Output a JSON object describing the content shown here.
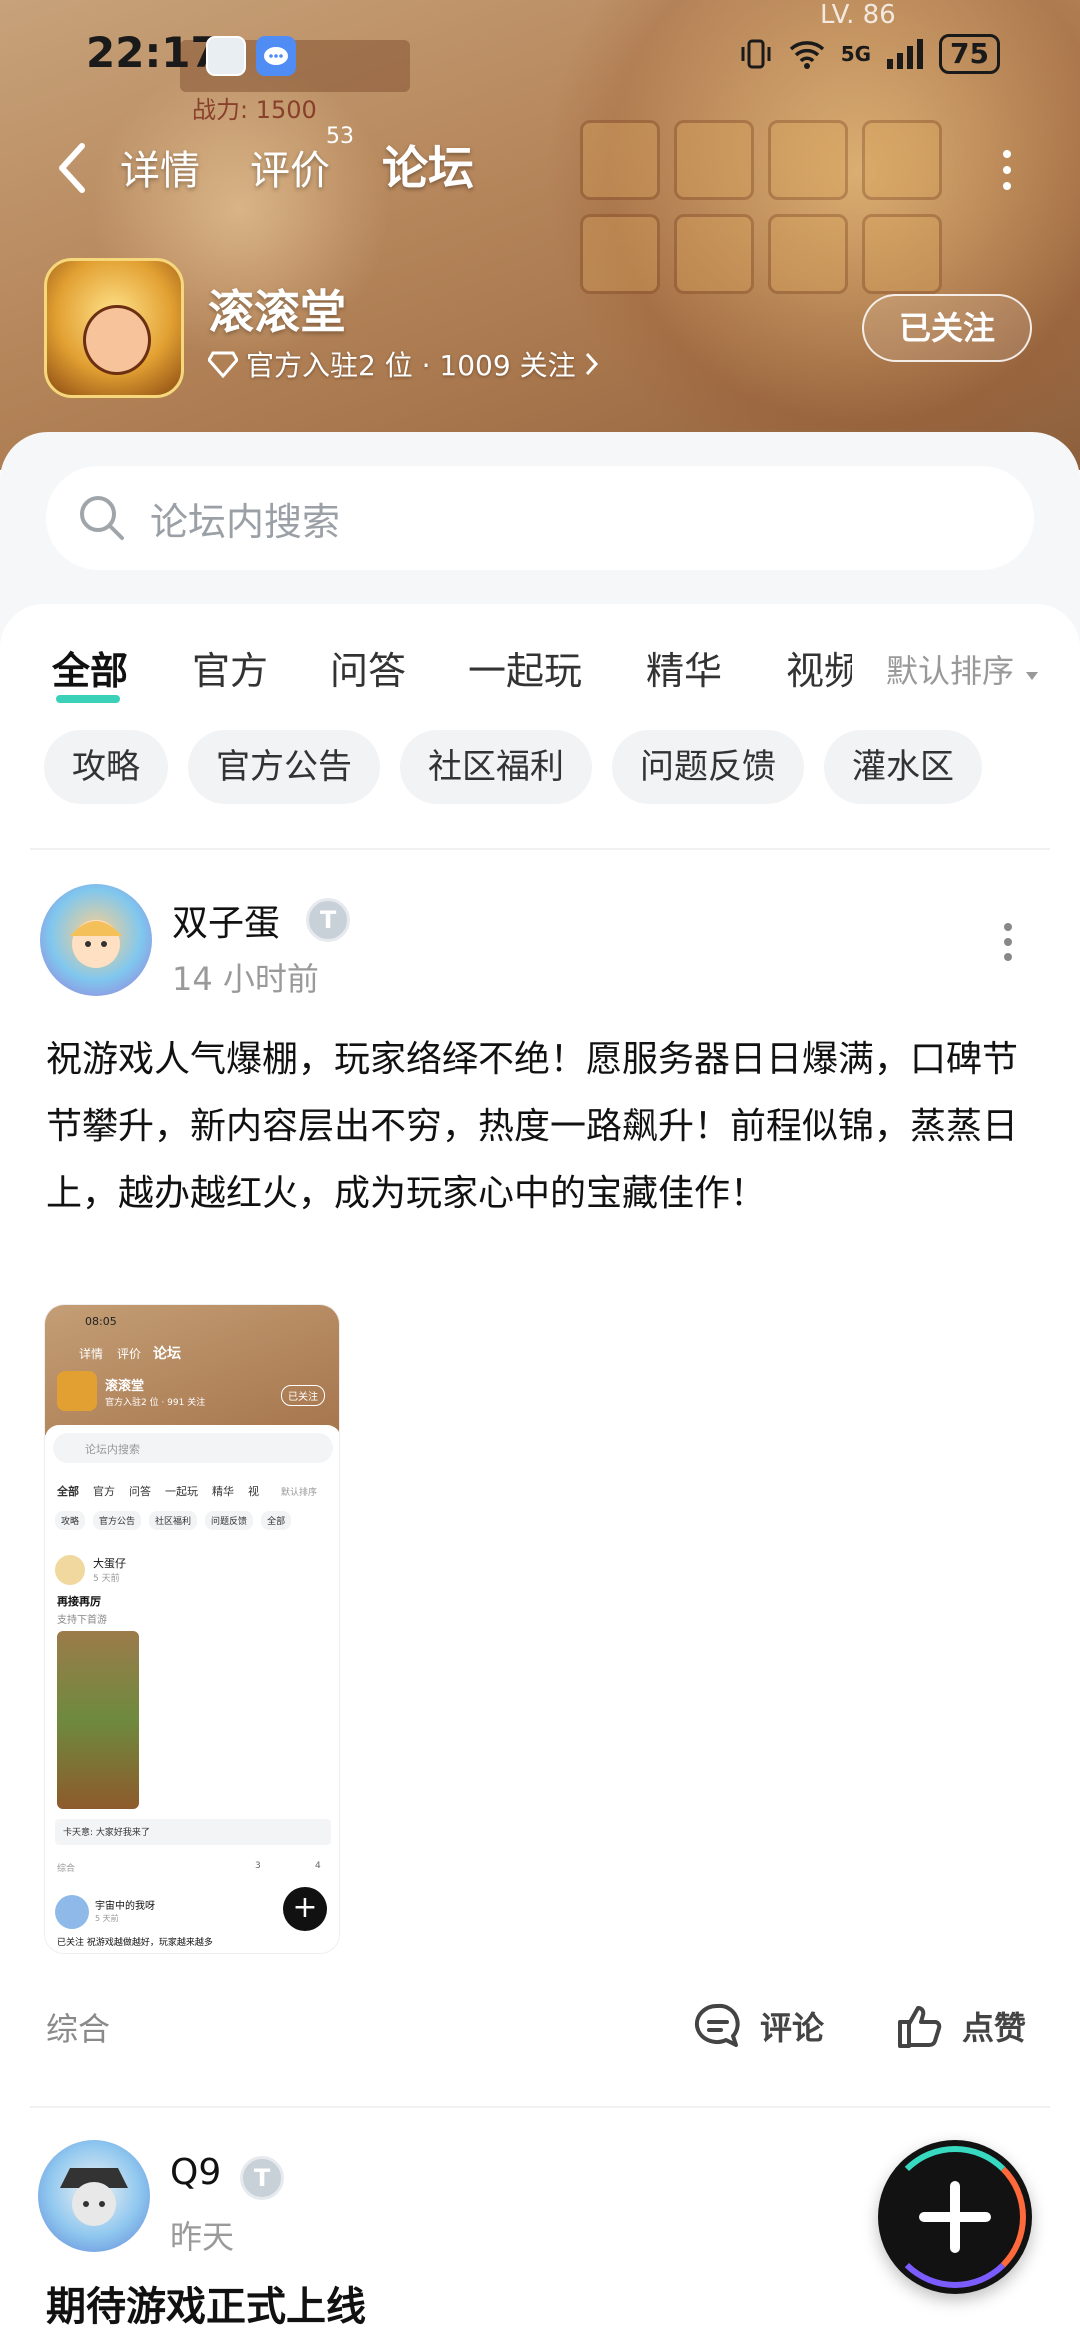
{
  "status_bar": {
    "time": "22:17",
    "signal": "5G",
    "battery": "75"
  },
  "hero": {
    "game_level": "LV. 86",
    "power_label": "战力: 1500"
  },
  "nav": {
    "tabs": [
      {
        "label": "详情"
      },
      {
        "label": "评价",
        "badge": "53"
      },
      {
        "label": "论坛"
      }
    ],
    "active": "论坛"
  },
  "app": {
    "name": "滚滚堂",
    "meta": "官方入驻2 位 · 1009 关注",
    "follow_label": "已关注"
  },
  "search": {
    "placeholder": "论坛内搜索"
  },
  "forum_tabs": [
    "全部",
    "官方",
    "问答",
    "一起玩",
    "精华",
    "视频"
  ],
  "sort_label": "默认排序",
  "chips": [
    "攻略",
    "官方公告",
    "社区福利",
    "问题反馈",
    "灌水区"
  ],
  "posts": [
    {
      "author": "双子蛋",
      "badge": "T",
      "time": "14 小时前",
      "content": "祝游戏人气爆棚，玩家络绎不绝！愿服务器日日爆满，口碑节节攀升，新内容层出不穷，热度一路飙升！前程似锦，蒸蒸日上，越办越红火，成为玩家心中的宝藏佳作！",
      "category": "综合",
      "comment_label": "评论",
      "like_label": "点赞"
    },
    {
      "author": "Q9",
      "badge": "T",
      "time": "昨天",
      "title": "期待游戏正式上线"
    }
  ],
  "thumbnail": {
    "time": "08:05",
    "tabs": [
      "详情",
      "评价",
      "论坛"
    ],
    "app_name": "滚滚堂",
    "app_meta": "官方入驻2 位 · 991 关注",
    "follow": "已关注",
    "search": "论坛内搜索",
    "forum_tabs": [
      "全部",
      "官方",
      "问答",
      "一起玩",
      "精华",
      "视"
    ],
    "sort": "默认排序",
    "chips": [
      "攻略",
      "官方公告",
      "社区福利",
      "问题反馈",
      "全部"
    ],
    "post_author": "大蛋仔",
    "post_time": "5 天前",
    "post_title": "再接再厉",
    "post_sub": "支持下首游",
    "comment_preview": "卡天意: 大家好我来了",
    "post_cat": "综合",
    "comments": "3",
    "likes": "4",
    "next_author": "宇宙中的我呀",
    "next_time": "5 天前",
    "next_text": "已关注   祝游戏越做越好，玩家越来越多"
  },
  "colors": {
    "accent": "#3ad1b8",
    "hero": "#b98a5f",
    "chip_bg": "#f2f3f5"
  }
}
